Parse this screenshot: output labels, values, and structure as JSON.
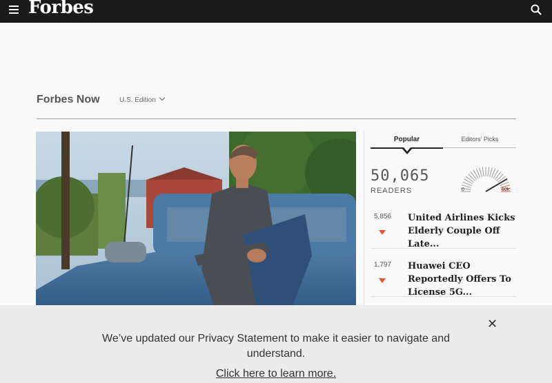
{
  "header": {
    "logo": "Forbes",
    "menu_icon": "hamburger-menu-icon",
    "search_icon": "search-icon"
  },
  "section": {
    "title": "Forbes Now",
    "edition": "U.S. Edition"
  },
  "hero": {
    "image": "man-sitting-on-car-photo"
  },
  "tabs": {
    "popular": "Popular",
    "editors": "Editors' Picks",
    "active": "Popular"
  },
  "readers": {
    "count": "50,065",
    "label": "READERS",
    "gauge_min": "0",
    "gauge_max": "60k",
    "level": 0.83
  },
  "stories": [
    {
      "count": "5,856",
      "title": "United Airlines Kicks Elderly Couple Off Late...",
      "trend": "down"
    },
    {
      "count": "1,797",
      "title": "Huawei CEO Reportedly Offers To License 5G...",
      "trend": "down"
    }
  ],
  "privacy": {
    "message": "We’ve updated our Privacy Statement to make it easier to navigate and understand.",
    "link": "Click here to learn more.",
    "close_icon": "close-icon"
  },
  "colors": {
    "topbar": "#1b1b1b",
    "accent_red": "#e2553b"
  }
}
